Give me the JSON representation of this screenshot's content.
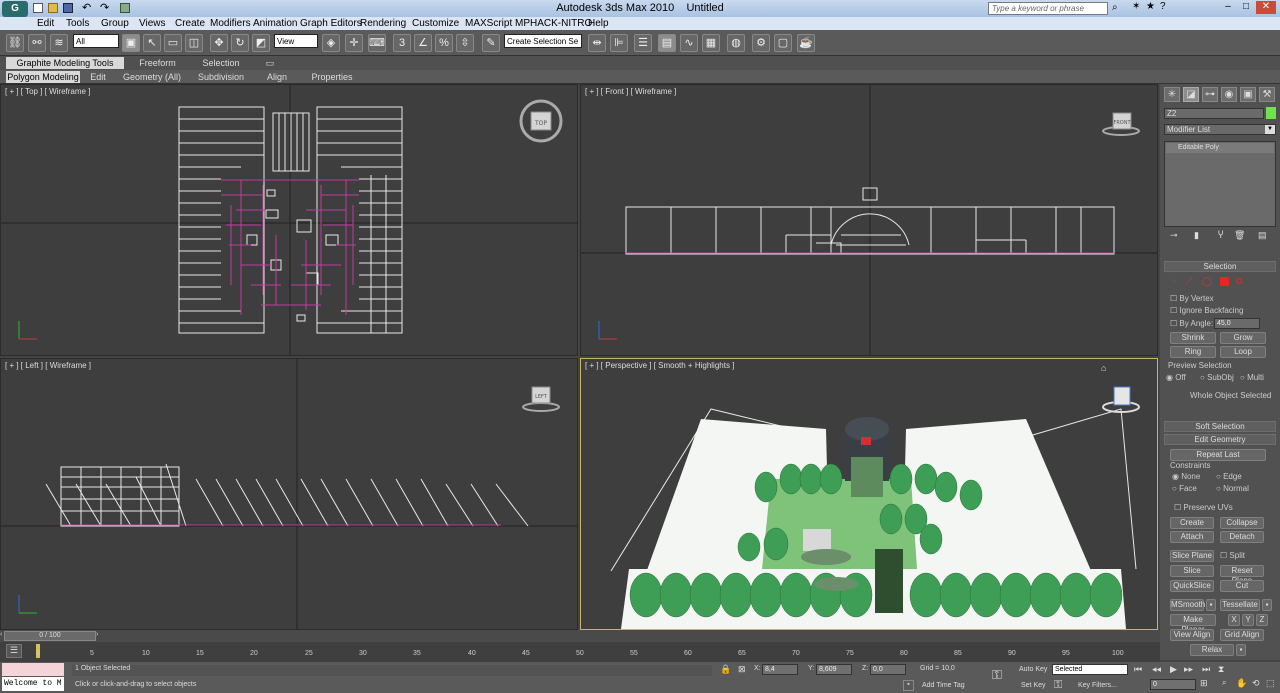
{
  "titlebar": {
    "app_title": "Autodesk 3ds Max  2010",
    "doc_title": "Untitled",
    "search_placeholder": "Type a keyword or phrase"
  },
  "menu": [
    "Edit",
    "Tools",
    "Group",
    "Views",
    "Create",
    "Modifiers",
    "Animation",
    "Graph Editors",
    "Rendering",
    "Customize",
    "MAXScript",
    "MPHACK-NITRO",
    "Help"
  ],
  "toolbar": {
    "filter_value": "All",
    "refcoord_value": "View",
    "selset_value": "Create Selection Se"
  },
  "ribbon": {
    "tabs": [
      "Graphite Modeling Tools",
      "Freeform",
      "Selection"
    ],
    "subtabs": [
      "Polygon Modeling",
      "Edit",
      "Geometry (All)",
      "Subdivision",
      "Align",
      "Properties"
    ]
  },
  "viewports": {
    "top": "[ + ] [ Top ] [ Wireframe ]",
    "front": "[ + ] [ Front ] [ Wireframe ]",
    "left": "[ + ] [ Left ] [ Wireframe ]",
    "persp": "[ + ] [ Perspective ] [ Smooth + Highlights ]",
    "cube_top": "TOP",
    "cube_front": "FRONT",
    "cube_left": "LEFT"
  },
  "cmd": {
    "object_name": "Z2",
    "modifier_list": "Modifier List",
    "stack_item": "Editable Poly",
    "selection": {
      "title": "Selection",
      "by_vertex": "By Vertex",
      "ignore_backfacing": "Ignore Backfacing",
      "by_angle": "By Angle:",
      "angle_value": "45,0",
      "shrink": "Shrink",
      "grow": "Grow",
      "ring": "Ring",
      "loop": "Loop",
      "preview_title": "Preview Selection",
      "off": "Off",
      "subobj": "SubObj",
      "multi": "Multi",
      "whole": "Whole Object Selected"
    },
    "soft_selection": "Soft Selection",
    "edit_geometry": {
      "title": "Edit Geometry",
      "repeat_last": "Repeat Last",
      "constraints": "Constraints",
      "none": "None",
      "edge": "Edge",
      "face": "Face",
      "normal": "Normal",
      "preserve_uvs": "Preserve UVs",
      "create": "Create",
      "collapse": "Collapse",
      "attach": "Attach",
      "detach": "Detach",
      "slice_plane": "Slice Plane",
      "split": "Split",
      "slice": "Slice",
      "reset_plane": "Reset Plane",
      "quickslice": "QuickSlice",
      "cut": "Cut",
      "msmooth": "MSmooth",
      "tessellate": "Tessellate",
      "make_planar": "Make Planar",
      "x": "X",
      "y": "Y",
      "z": "Z",
      "view_align": "View Align",
      "grid_align": "Grid Align",
      "relax": "Relax"
    }
  },
  "time": {
    "slider": "0 / 100",
    "ticks": [
      "0",
      "5",
      "10",
      "15",
      "20",
      "25",
      "30",
      "35",
      "40",
      "45",
      "50",
      "55",
      "60",
      "65",
      "70",
      "75",
      "80",
      "85",
      "90",
      "95",
      "100"
    ]
  },
  "status": {
    "welcome": "Welcome to M",
    "selected": "1 Object Selected",
    "prompt": "Click or click-and-drag to select objects",
    "x_label": "X:",
    "x_value": "8,4",
    "y_label": "Y:",
    "y_value": "8,609",
    "z_label": "Z:",
    "z_value": "0,0",
    "grid": "Grid = 10,0",
    "add_time_tag": "Add Time Tag",
    "auto_key": "Auto Key",
    "set_key": "Set Key",
    "selected_dd": "Selected",
    "key_filters": "Key Filters...",
    "frame": "0"
  },
  "colors": {
    "bg": "#444444",
    "viewport": "#3e3e3e",
    "selection_wire": "#c03ca0",
    "wire": "#e8e8e8",
    "grass": "#7fc27a",
    "tree": "#3e9e55",
    "snow": "#f5f7f5"
  }
}
